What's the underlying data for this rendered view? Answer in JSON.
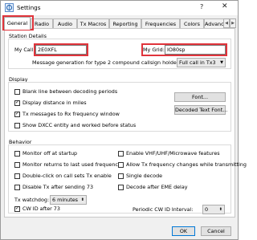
{
  "window": {
    "title": "Settings",
    "help_glyph": "?",
    "close_glyph": "✕"
  },
  "tabs": [
    {
      "label": "General",
      "active": true
    },
    {
      "label": "Radio"
    },
    {
      "label": "Audio"
    },
    {
      "label": "Tx Macros"
    },
    {
      "label": "Reporting"
    },
    {
      "label": "Frequencies"
    },
    {
      "label": "Colors"
    },
    {
      "label": "Advanced"
    }
  ],
  "tab_arrows": [
    "◀",
    "▶"
  ],
  "station": {
    "title": "Station Details",
    "my_call_label": "My Call:",
    "my_call_value": "2E0XFL",
    "my_grid_label": "My Grid:",
    "my_grid_value": "IO80sp",
    "type2_label": "Message generation for type 2 compound callsign holders:",
    "type2_value": "Full call in Tx3"
  },
  "display": {
    "title": "Display",
    "items": [
      {
        "label": "Blank line between decoding periods",
        "checked": false
      },
      {
        "label": "Display distance in miles",
        "checked": true
      },
      {
        "label": "Tx messages to Rx frequency window",
        "checked": true
      },
      {
        "label": "Show DXCC entity and worked before status",
        "checked": false
      }
    ],
    "font_button": "Font...",
    "decoded_font_button": "Decoded Text Font..."
  },
  "behavior": {
    "title": "Behavior",
    "left": [
      {
        "label": "Monitor off at startup",
        "checked": false
      },
      {
        "label": "Monitor returns to last used frequency",
        "checked": false
      },
      {
        "label": "Double-click on call sets Tx enable",
        "checked": false
      },
      {
        "label": "Disable Tx after sending 73",
        "checked": false
      }
    ],
    "right": [
      {
        "label": "Enable VHF/UHF/Microwave features",
        "checked": false
      },
      {
        "label": "Allow Tx frequency changes while transmitting",
        "checked": false
      },
      {
        "label": "Single decode",
        "checked": false
      },
      {
        "label": "Decode after EME delay",
        "checked": false
      }
    ],
    "watchdog_label": "Tx watchdog:",
    "watchdog_value": "6 minutes",
    "cw_id": {
      "label": "CW ID after 73",
      "checked": true
    },
    "periodic_label": "Periodic CW ID Interval:",
    "periodic_value": "0"
  },
  "footer": {
    "ok": "OK",
    "cancel": "Cancel"
  },
  "colors": {
    "highlight": "#e0343b",
    "accent": "#0078d7"
  }
}
